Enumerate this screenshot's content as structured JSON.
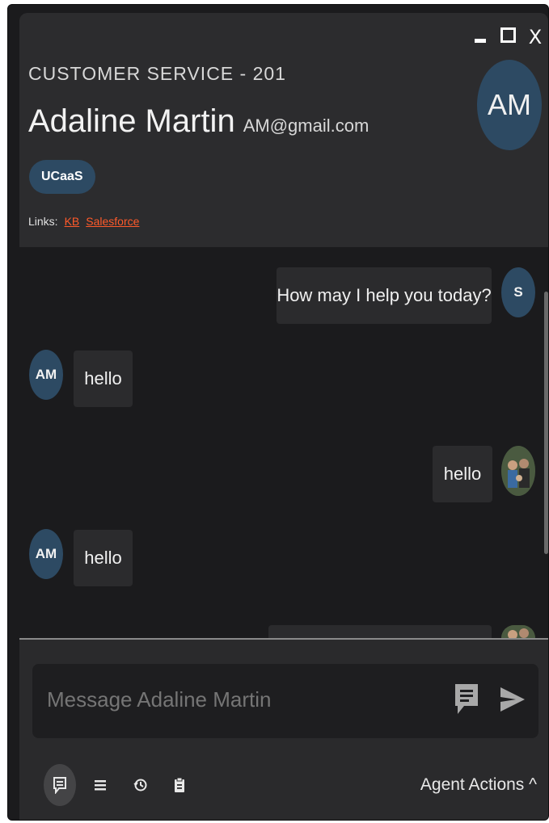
{
  "window": {
    "controls": {
      "minimize": "minimize",
      "maximize": "maximize",
      "close": "X"
    }
  },
  "header": {
    "queue": "CUSTOMER SERVICE - 201",
    "customer_name": "Adaline Martin",
    "customer_email": "AM@gmail.com",
    "avatar_initials": "AM",
    "tag": "UCaaS",
    "links_label": "Links:",
    "links": [
      "KB",
      "Salesforce"
    ]
  },
  "messages": [
    {
      "sender": "agent",
      "avatar": "S",
      "text": "How may I help you today?"
    },
    {
      "sender": "customer",
      "avatar": "AM",
      "text": "hello"
    },
    {
      "sender": "agent",
      "avatar": "photo",
      "text": "hello"
    },
    {
      "sender": "customer",
      "avatar": "AM",
      "text": "hello"
    },
    {
      "sender": "agent",
      "avatar": "photo",
      "text": ""
    }
  ],
  "composer": {
    "placeholder": "Message Adaline Martin",
    "icons": [
      "canned-response-icon",
      "send-icon"
    ]
  },
  "bottom_bar": {
    "icons": [
      "chat-icon",
      "list-icon",
      "history-icon",
      "clipboard-icon"
    ],
    "agent_actions_label": "Agent Actions ^"
  },
  "colors": {
    "background": "#1b1b1d",
    "header": "#2c2c2e",
    "bubble": "#2b2b2d",
    "avatar": "#2d4a63",
    "link": "#ff5a2a",
    "placeholder": "#6f6f6f"
  }
}
